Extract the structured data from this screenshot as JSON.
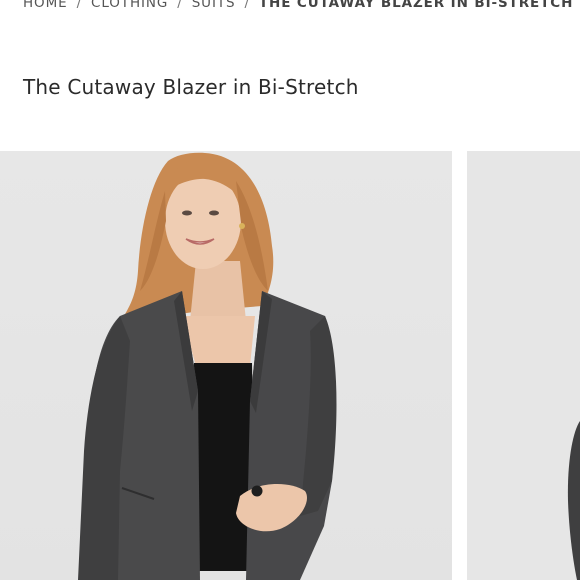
{
  "breadcrumb": {
    "items": [
      "HOME",
      "CLOTHING",
      "SUITS"
    ],
    "separator": "/",
    "current": "THE CUTAWAY BLAZER IN BI-STRETCH"
  },
  "product": {
    "title": "The Cutaway Blazer in Bi-Stretch"
  },
  "gallery": {
    "images": [
      {
        "alt": "product-photo-front",
        "icon": "model-front-view"
      },
      {
        "alt": "product-photo-side",
        "icon": "model-side-view"
      }
    ]
  },
  "colors": {
    "blazer": "#4a4a4b",
    "top": "#141414",
    "hair": "#c98a52",
    "background": "#e5e5e5"
  }
}
